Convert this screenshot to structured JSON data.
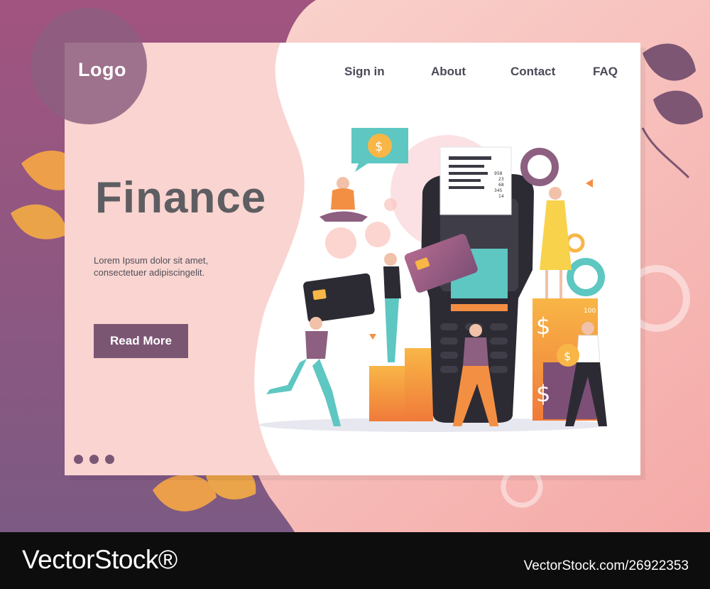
{
  "header": {
    "logo": "Logo",
    "nav": [
      {
        "label": "Sign in"
      },
      {
        "label": "About"
      },
      {
        "label": "Contact"
      },
      {
        "label": "FAQ"
      }
    ]
  },
  "hero": {
    "title": "Finance",
    "description": "Lorem Ipsum dolor sit amet, consectetuer adipiscingelit.",
    "button_label": "Read More"
  },
  "illustration": {
    "receipt_numbers": [
      "958",
      "23",
      "68",
      "345",
      "14"
    ],
    "banknote_value": "100"
  },
  "pagination": {
    "count": 3
  },
  "watermark": {
    "brand": "VectorStock®",
    "id": "VectorStock.com/26922353"
  },
  "colors": {
    "accent": "#7b5673",
    "background": "#f6b3ad",
    "text": "#4a4a58"
  }
}
